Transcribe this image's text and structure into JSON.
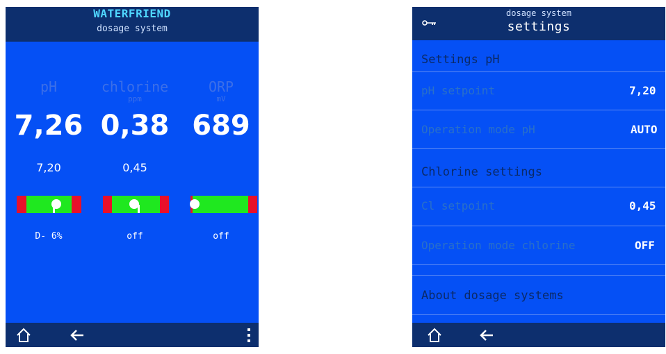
{
  "left_screen": {
    "title": "WATERFRIEND",
    "subtitle": "dosage system",
    "ph": {
      "label": "pH",
      "unit": "",
      "value": "7,26",
      "setpoint": "7,20",
      "status": "D- 6%",
      "marker_fraction": 0.61
    },
    "chlorine": {
      "label": "chlorine",
      "unit": "ppm",
      "value": "0,38",
      "setpoint": "0,45",
      "status": "off",
      "marker_fraction": 0.47
    },
    "orp": {
      "label": "ORP",
      "unit": "mV",
      "value": "689",
      "setpoint": "",
      "status": "off",
      "marker_fraction": 0.06
    },
    "icons": {
      "home": "home-icon",
      "back": "back-arrow-icon",
      "menu": "more-vertical-icon"
    }
  },
  "right_screen": {
    "subtitle": "dosage system",
    "title": "settings",
    "key_icon": "key-icon",
    "rows": [
      {
        "kind": "section",
        "label": "Settings pH",
        "value": ""
      },
      {
        "kind": "item",
        "label": "pH setpoint",
        "value": "7,20"
      },
      {
        "kind": "item",
        "label": "Operation mode pH",
        "value": "AUTO"
      },
      {
        "kind": "section",
        "label": "Chlorine settings",
        "value": ""
      },
      {
        "kind": "item",
        "label": "Cl setpoint",
        "value": "0,45"
      },
      {
        "kind": "item",
        "label": "Operation mode chlorine",
        "value": "OFF"
      },
      {
        "kind": "section",
        "label": "About dosage systems",
        "value": ""
      }
    ],
    "icons": {
      "home": "home-icon",
      "back": "back-arrow-icon"
    }
  },
  "colors": {
    "screen_bg": "#0550f5",
    "bar_bg": "#0d2f6e",
    "red": "#e8102a",
    "green": "#1fe81f",
    "title_accent": "#4fd6ff"
  }
}
